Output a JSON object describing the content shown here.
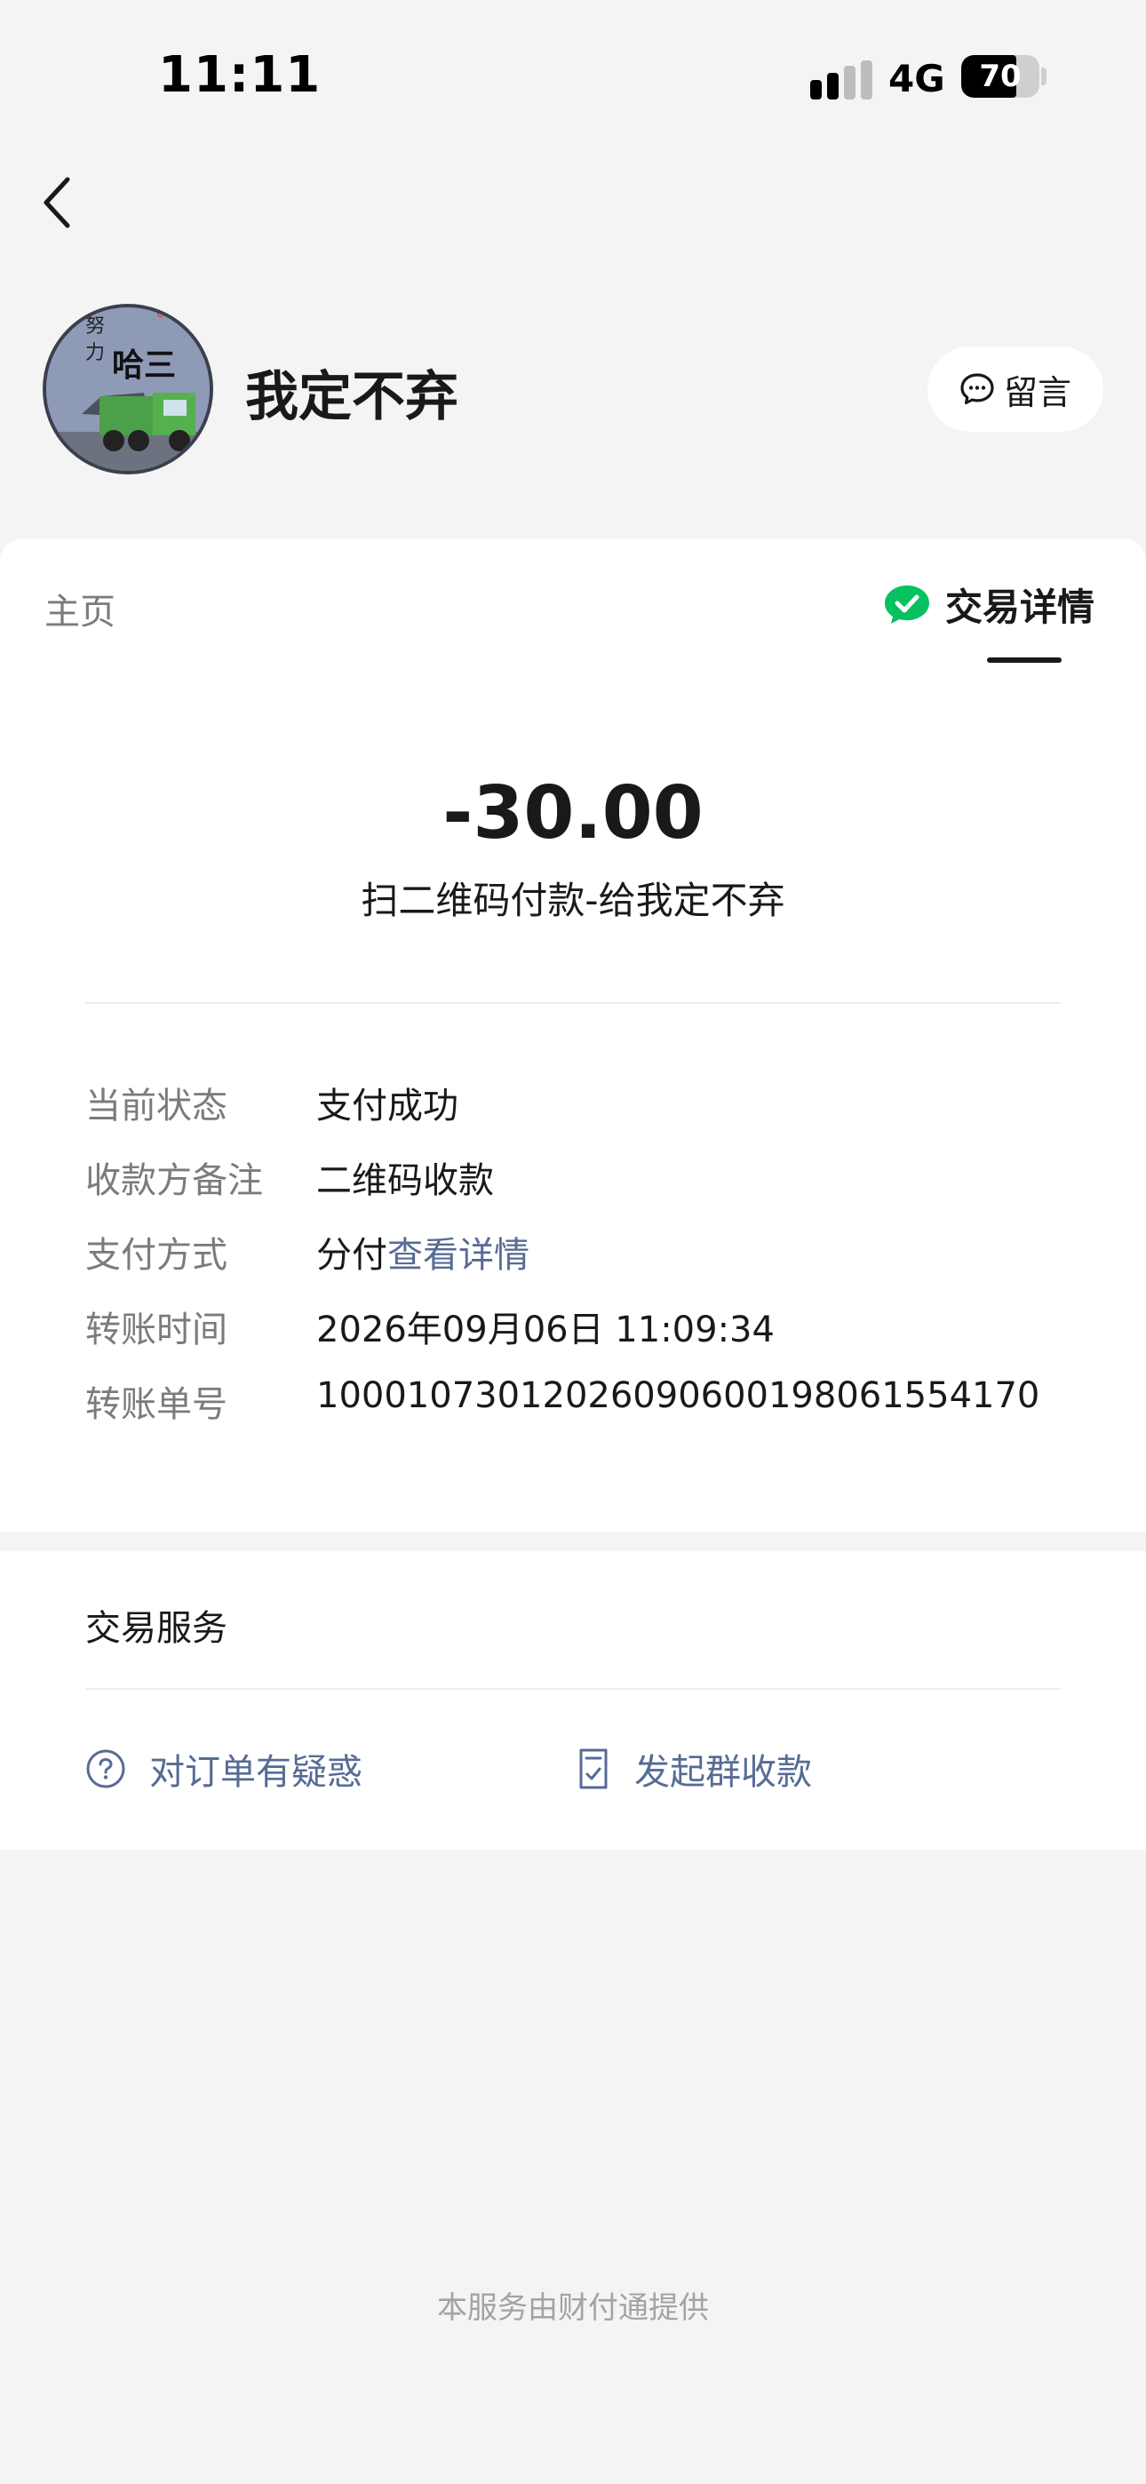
{
  "status_bar": {
    "time": "11:11",
    "network": "4G",
    "battery": "70",
    "battery_level": 0.7
  },
  "header": {
    "back_icon": "chevron-left-icon",
    "avatar_text": "哈三",
    "name": "我定不弃",
    "message_button": {
      "icon": "chat-bubble-icon",
      "label": "留言"
    }
  },
  "tabs": {
    "home": "主页",
    "detail": {
      "icon": "wechat-pay-icon",
      "label": "交易详情"
    }
  },
  "transaction": {
    "amount": "-30.00",
    "description": "扫二维码付款-给我定不弃",
    "details": [
      {
        "label": "当前状态",
        "value": "支付成功"
      },
      {
        "label": "收款方备注",
        "value": "二维码收款"
      },
      {
        "label": "支付方式",
        "value": "分付",
        "link": "查看详情"
      },
      {
        "label": "转账时间",
        "value": "2026年09月06日 11:09:34"
      },
      {
        "label": "转账单号",
        "value": "10001073012026090600198061554170"
      }
    ]
  },
  "services": {
    "title": "交易服务",
    "items": [
      {
        "icon": "question-circle-icon",
        "label": "对订单有疑惑"
      },
      {
        "icon": "document-check-icon",
        "label": "发起群收款"
      }
    ]
  },
  "footer": "本服务由财付通提供",
  "colors": {
    "link": "#576b95",
    "wechat_green": "#07c160",
    "background": "#f4f4f4"
  }
}
